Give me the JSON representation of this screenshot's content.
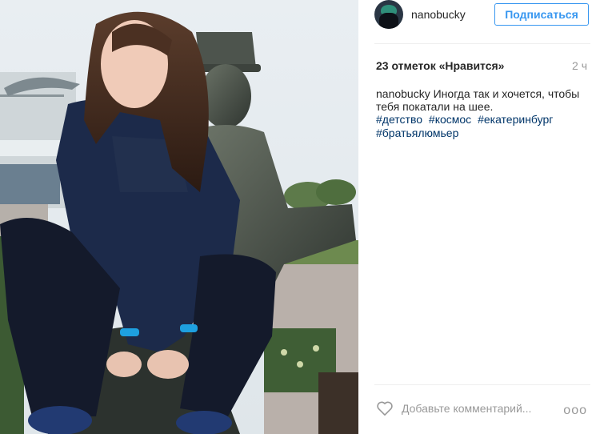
{
  "post": {
    "username": "nanobucky",
    "follow_label": "Подписаться",
    "likes": "23 отметок «Нравится»",
    "time": "2 ч",
    "caption_user": "nanobucky",
    "caption_text": "Иногда так и хочется, чтобы тебя покатали на шее.",
    "hashtags": [
      "#детство",
      "#космос",
      "#екатеринбург",
      "#братьялюмьер"
    ],
    "comment_placeholder": "Добавьте комментарий...",
    "more_label": "ooo"
  },
  "icons": {
    "avatar": "avatar",
    "like": "heart-icon",
    "more": "more-options-icon"
  },
  "colors": {
    "accent": "#3897f0",
    "hashtag": "#003569",
    "muted": "#999999"
  }
}
